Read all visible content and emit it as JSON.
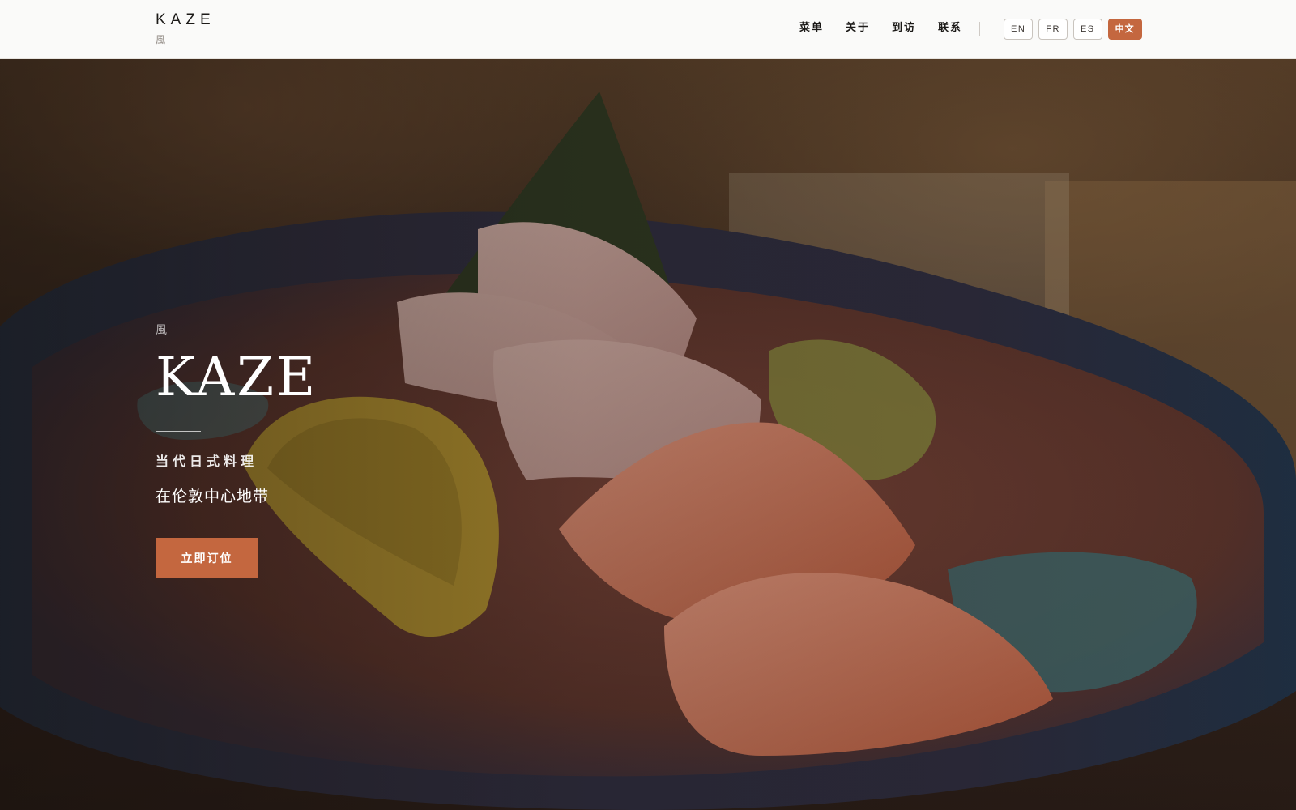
{
  "header": {
    "brand": {
      "name": "KAZE",
      "kanji": "風"
    },
    "nav": [
      {
        "label": "菜单"
      },
      {
        "label": "关于"
      },
      {
        "label": "到访"
      },
      {
        "label": "联系"
      }
    ],
    "languages": [
      {
        "label": "EN",
        "active": false
      },
      {
        "label": "FR",
        "active": false
      },
      {
        "label": "ES",
        "active": false
      },
      {
        "label": "中文",
        "active": true
      }
    ]
  },
  "hero": {
    "kanji": "風",
    "title": "KAZE",
    "eyebrow": "当代日式料理",
    "tagline": "在伦敦中心地带",
    "cta_label": "立即订位",
    "background_image": "sashimi-plate-photo"
  },
  "colors": {
    "accent": "#c4673f",
    "header_bg": "#fafaf9",
    "text_dark": "#1c1a18"
  }
}
